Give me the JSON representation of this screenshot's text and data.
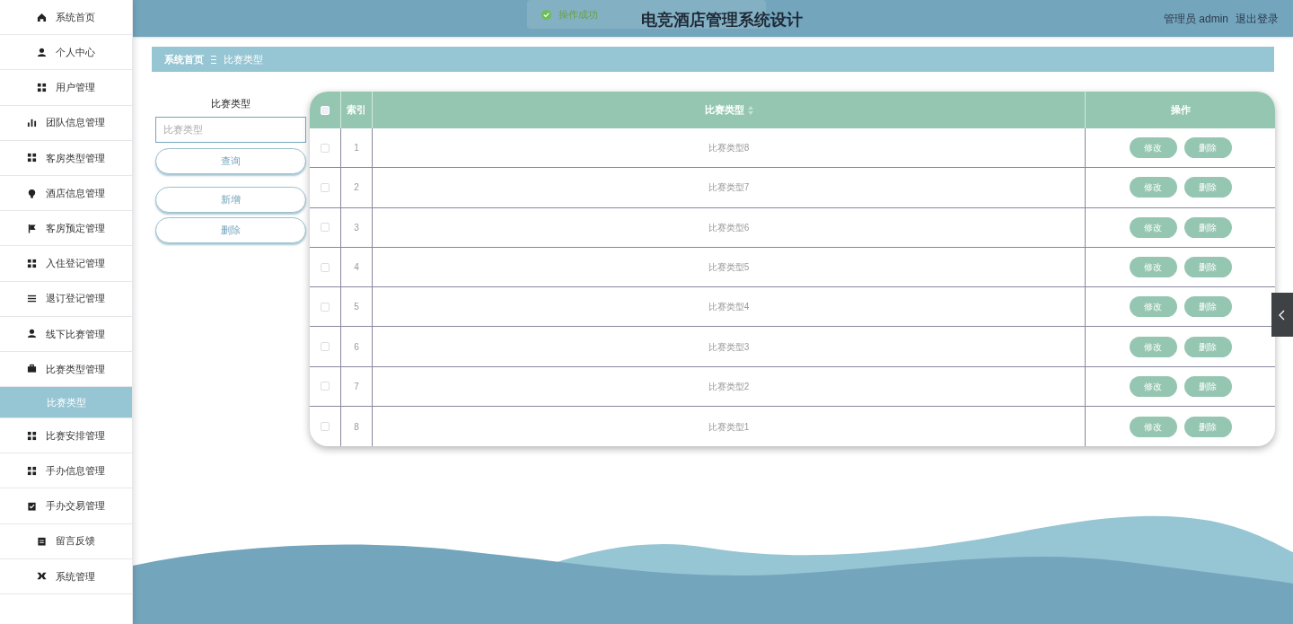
{
  "sidebar": {
    "items": [
      {
        "label": "系统首页",
        "selected": false
      },
      {
        "label": "个人中心",
        "selected": false
      },
      {
        "label": "用户管理",
        "selected": false
      },
      {
        "label": "团队信息管理",
        "selected": false
      },
      {
        "label": "客房类型管理",
        "selected": false
      },
      {
        "label": "酒店信息管理",
        "selected": false
      },
      {
        "label": "客房预定管理",
        "selected": false
      },
      {
        "label": "入住登记管理",
        "selected": false
      },
      {
        "label": "退订登记管理",
        "selected": false
      },
      {
        "label": "线下比赛管理",
        "selected": false
      },
      {
        "label": "比赛类型管理",
        "selected": false,
        "expanded": true,
        "children": [
          {
            "label": "比赛类型",
            "selected": true
          }
        ]
      },
      {
        "label": "比赛安排管理",
        "selected": false
      },
      {
        "label": "手办信息管理",
        "selected": false
      },
      {
        "label": "手办交易管理",
        "selected": false
      },
      {
        "label": "留言反馈",
        "selected": false
      },
      {
        "label": "系统管理",
        "selected": false
      }
    ]
  },
  "header": {
    "title": "电竞酒店管理系统设计",
    "user": "管理员 admin",
    "logout": "退出登录"
  },
  "toast": {
    "message": "操作成功"
  },
  "breadcrumb": [
    "系统首页",
    "比赛类型"
  ],
  "search": {
    "label": "比赛类型",
    "placeholder": "比赛类型",
    "buttons": [
      "查询",
      "新增",
      "删除"
    ]
  },
  "table": {
    "select_all_checked": false,
    "columns": [
      "索引",
      "比赛类型",
      "操作"
    ],
    "rows": [
      {
        "checked": false,
        "index": "1",
        "name": "比赛类型8",
        "actions": [
          "修改",
          "删除"
        ]
      },
      {
        "checked": false,
        "index": "2",
        "name": "比赛类型7",
        "actions": [
          "修改",
          "删除"
        ]
      },
      {
        "checked": false,
        "index": "3",
        "name": "比赛类型6",
        "actions": [
          "修改",
          "删除"
        ]
      },
      {
        "checked": false,
        "index": "4",
        "name": "比赛类型5",
        "actions": [
          "修改",
          "删除"
        ]
      },
      {
        "checked": false,
        "index": "5",
        "name": "比赛类型4",
        "actions": [
          "修改",
          "删除"
        ]
      },
      {
        "checked": false,
        "index": "6",
        "name": "比赛类型3",
        "actions": [
          "修改",
          "删除"
        ]
      },
      {
        "checked": false,
        "index": "7",
        "name": "比赛类型2",
        "actions": [
          "修改",
          "删除"
        ]
      },
      {
        "checked": false,
        "index": "8",
        "name": "比赛类型1",
        "actions": [
          "修改",
          "删除"
        ]
      }
    ]
  }
}
